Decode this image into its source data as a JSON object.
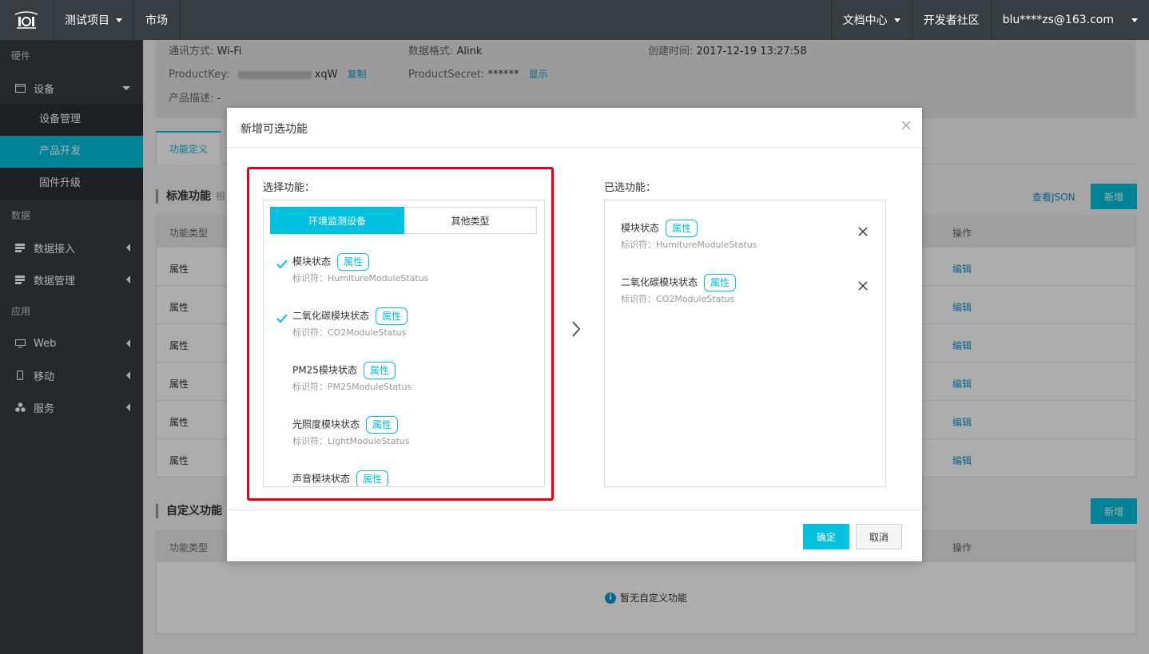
{
  "topbar": {
    "project": "测试项目",
    "market": "市场",
    "docs": "文档中心",
    "community": "开发者社区",
    "user": "blu****zs@163.com"
  },
  "sidebar": {
    "sec_hardware": "硬件",
    "device": "设备",
    "device_mgmt": "设备管理",
    "product_dev": "产品开发",
    "firmware": "固件升级",
    "sec_data": "数据",
    "data_access": "数据接入",
    "data_mgmt": "数据管理",
    "sec_app": "应用",
    "web": "Web",
    "mobile": "移动",
    "service": "服务"
  },
  "info": {
    "comm_label": "通讯方式:",
    "comm_value": "Wi-Fi",
    "format_label": "数据格式:",
    "format_value": "Alink",
    "created_label": "创建时间:",
    "created_value": "2017-12-19 13:27:58",
    "pk_label": "ProductKey:",
    "pk_tail": "xqW",
    "copy": "复制",
    "ps_label": "ProductSecret:",
    "ps_value": "******",
    "show": "显示",
    "desc_label": "产品描述:",
    "desc_value": "-"
  },
  "tabs": {
    "func_def": "功能定义"
  },
  "standard": {
    "title": "标准功能",
    "note": "根",
    "view_json": "查看JSON",
    "new": "新增",
    "col_type": "功能类型",
    "col_op": "操作",
    "rows": [
      "属性",
      "属性",
      "属性",
      "属性",
      "属性",
      "属性"
    ],
    "edit": "编辑"
  },
  "custom": {
    "title": "自定义功能",
    "new": "新增",
    "col_type": "功能类型",
    "col_op": "操作",
    "empty": "暂无自定义功能"
  },
  "modal": {
    "title": "新增可选功能",
    "select_label": "选择功能：",
    "selected_label": "已选功能：",
    "seg_env": "环境监测设备",
    "seg_other": "其他类型",
    "options": [
      {
        "name": "模块状态",
        "tag": "属性",
        "id": "标识符：HumitureModuleStatus"
      },
      {
        "name": "二氧化碳模块状态",
        "tag": "属性",
        "id": "标识符：CO2ModuleStatus"
      },
      {
        "name": "PM25模块状态",
        "tag": "属性",
        "id": "标识符：PM25ModuleStatus"
      },
      {
        "name": "光照度模块状态",
        "tag": "属性",
        "id": "标识符：LightModuleStatus"
      },
      {
        "name": "声音模块状态",
        "tag": "属性",
        "id": ""
      }
    ],
    "selected": [
      {
        "name": "模块状态",
        "tag": "属性",
        "id": "标识符：HumitureModuleStatus"
      },
      {
        "name": "二氧化碳模块状态",
        "tag": "属性",
        "id": "标识符：CO2ModuleStatus"
      }
    ],
    "ok": "确定",
    "cancel": "取消"
  },
  "colors": {
    "accent": "#00c1de",
    "link": "#0a99d6",
    "highlight": "#e60012",
    "dark": "#373d41"
  }
}
